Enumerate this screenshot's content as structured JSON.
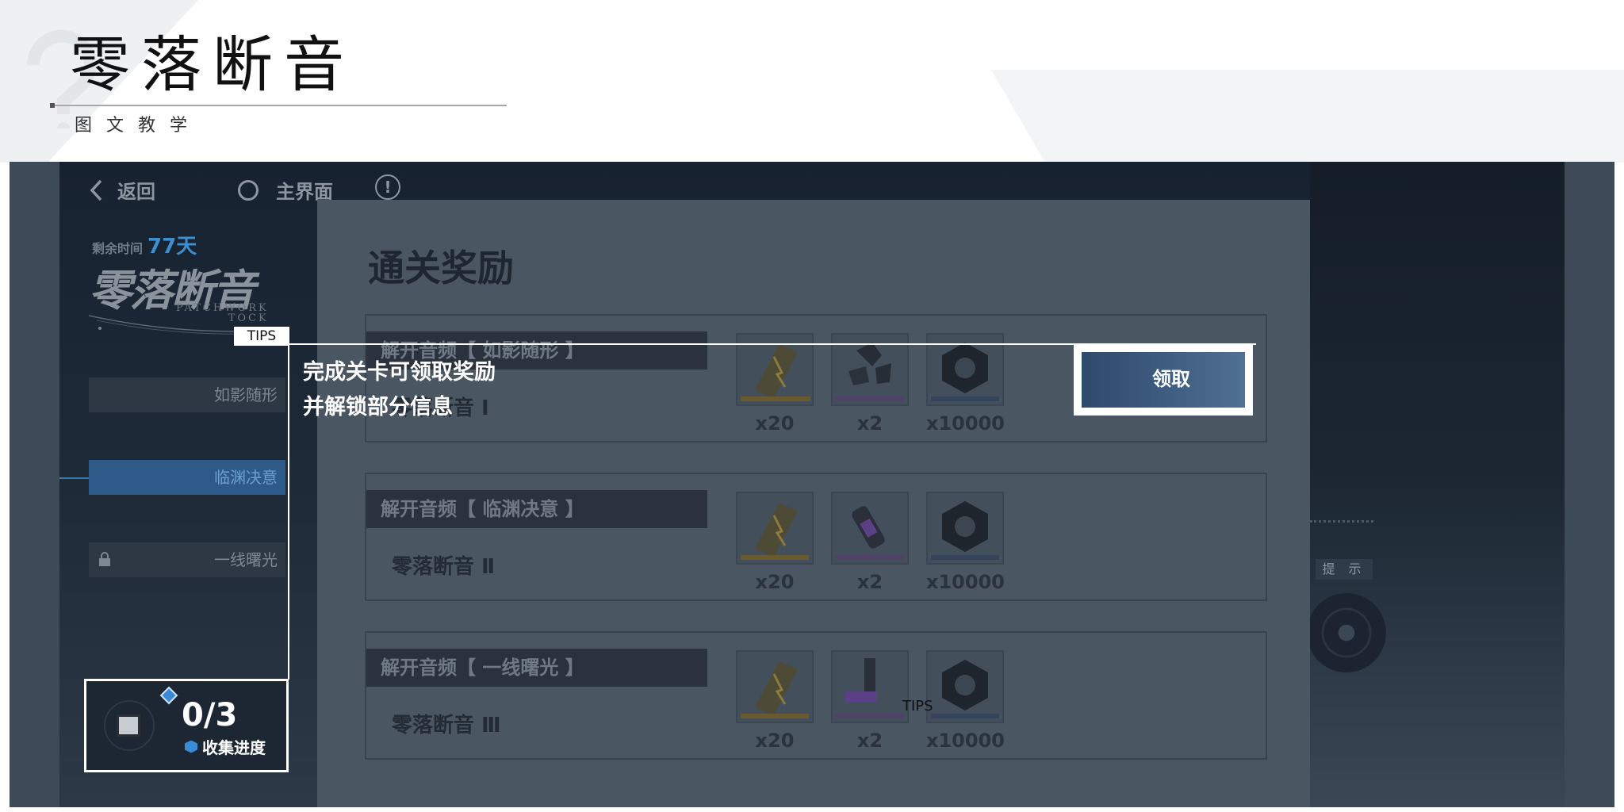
{
  "slide": {
    "title": "零落断音",
    "subtitle": "图文教学"
  },
  "nav": {
    "back_label": "返回",
    "home_label": "主界面",
    "info_glyph": "!"
  },
  "event": {
    "remaining_label": "剩余时间",
    "remaining_days": "77天",
    "logo_text": "零落断音",
    "logo_sub_line1": "PATCHWORK",
    "logo_sub_line2": "TOCK"
  },
  "stages": [
    {
      "label": "如影随形",
      "active": false,
      "locked": false
    },
    {
      "label": "临渊决意",
      "active": true,
      "locked": false
    },
    {
      "label": "一线曙光",
      "active": false,
      "locked": true
    }
  ],
  "hint_label": "提 示",
  "modal": {
    "title": "通关奖励",
    "rows": [
      {
        "head": "解开音频【 如影随形 】",
        "name": "零落断音 Ⅰ",
        "counts": [
          "x20",
          "x2",
          "x10000"
        ]
      },
      {
        "head": "解开音频【 临渊决意 】",
        "name": "零落断音 Ⅱ",
        "counts": [
          "x20",
          "x2",
          "x10000"
        ]
      },
      {
        "head": "解开音频【 一线曙光 】",
        "name": "零落断音 Ⅲ",
        "counts": [
          "x20",
          "x2",
          "x10000"
        ]
      }
    ],
    "claim_label": "领取"
  },
  "tips": {
    "tag": "TIPS",
    "line1": "完成关卡可领取奖励",
    "line2": "并解锁部分信息",
    "tag2": "TIPS"
  },
  "collection": {
    "count": "0/3",
    "label": "收集进度"
  },
  "colors": {
    "accent_blue": "#3e8ed0",
    "modal_bg": "#4b5663",
    "tips_white": "#ffffff"
  },
  "icons": [
    "chevron-left-icon",
    "home-ring-icon",
    "info-icon",
    "lock-icon",
    "vinyl-record-icon",
    "gold-ticket-icon",
    "black-crystal-icon",
    "purple-capsule-icon",
    "hex-nut-icon",
    "cube-icon",
    "diamond-icon",
    "hexagon-icon"
  ]
}
